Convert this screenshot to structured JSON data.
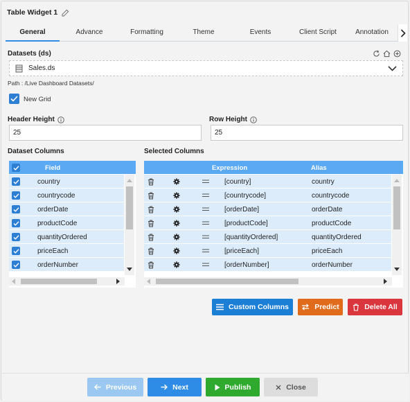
{
  "title": "Table Widget 1",
  "tabs": [
    "General",
    "Advance",
    "Formatting",
    "Theme",
    "Events",
    "Client Script",
    "Annotation"
  ],
  "datasets": {
    "label": "Datasets (ds)",
    "selected": "Sales.ds",
    "path": "Path : /Live Dashboard Datasets/"
  },
  "new_grid": {
    "label": "New Grid",
    "checked": true
  },
  "header_height": {
    "label": "Header Height",
    "value": "25"
  },
  "row_height": {
    "label": "Row Height",
    "value": "25"
  },
  "dataset_columns": {
    "label": "Dataset Columns",
    "header": "Field",
    "rows": [
      "country",
      "countrycode",
      "orderDate",
      "productCode",
      "quantityOrdered",
      "priceEach",
      "orderNumber"
    ]
  },
  "selected_columns": {
    "label": "Selected Columns",
    "headers": {
      "expression": "Expression",
      "alias": "Alias"
    },
    "rows": [
      {
        "expression": "[country]",
        "alias": "country"
      },
      {
        "expression": "[countrycode]",
        "alias": "countrycode"
      },
      {
        "expression": "[orderDate]",
        "alias": "orderDate"
      },
      {
        "expression": "[productCode]",
        "alias": "productCode"
      },
      {
        "expression": "[quantityOrdered]",
        "alias": "quantityOrdered"
      },
      {
        "expression": "[priceEach]",
        "alias": "priceEach"
      },
      {
        "expression": "[orderNumber]",
        "alias": "orderNumber"
      }
    ]
  },
  "actions": {
    "custom_columns": "Custom Columns",
    "predict": "Predict",
    "delete_all": "Delete All"
  },
  "footer": {
    "previous": "Previous",
    "next": "Next",
    "publish": "Publish",
    "close": "Close"
  },
  "icons": [
    "edit-icon",
    "refresh-icon",
    "home-icon",
    "add-circle-icon",
    "database-icon",
    "chevron-down-icon",
    "info-icon",
    "trash-icon",
    "gear-icon",
    "drag-handle-icon",
    "list-icon",
    "swap-icon",
    "arrow-left-icon",
    "arrow-right-icon",
    "play-icon",
    "close-icon"
  ],
  "colors": {
    "accent": "#2e8be6",
    "header_blue": "#5aa9f2",
    "row_blue": "#dcecfb",
    "custom": "#1c7fd6",
    "predict": "#e06b1b",
    "delete": "#d9363e",
    "publish": "#2faa2f"
  }
}
